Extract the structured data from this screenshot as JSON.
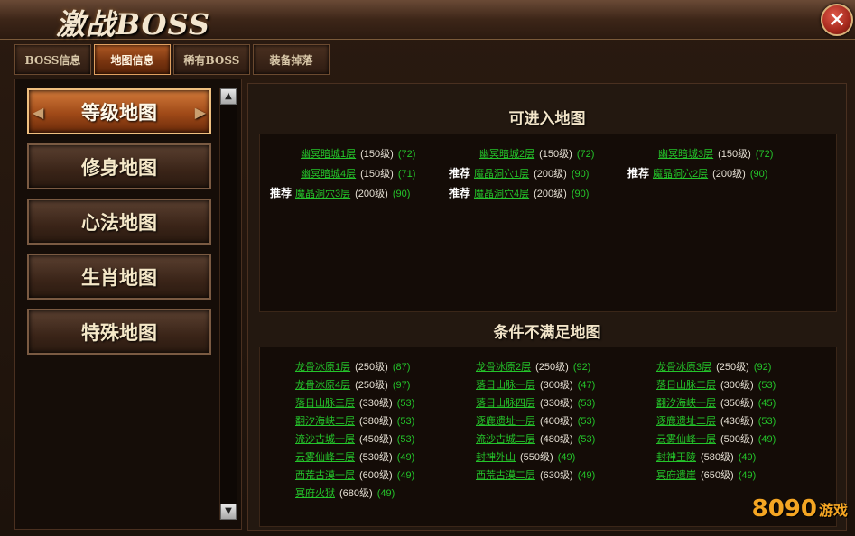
{
  "window": {
    "title": "激战BOSS",
    "close_label": "✕"
  },
  "tabs": [
    {
      "label": "BOSS信息",
      "active": false
    },
    {
      "label": "地图信息",
      "active": true
    },
    {
      "label": "稀有BOSS",
      "active": false
    },
    {
      "label": "装备掉落",
      "active": false
    }
  ],
  "map_categories": [
    {
      "label": "等级地图",
      "active": true
    },
    {
      "label": "修身地图",
      "active": false
    },
    {
      "label": "心法地图",
      "active": false
    },
    {
      "label": "生肖地图",
      "active": false
    },
    {
      "label": "特殊地图",
      "active": false
    }
  ],
  "scroll": {
    "up": "▲",
    "down": "▼"
  },
  "accessible": {
    "title": "可进入地图",
    "rec_label": "推荐",
    "entries": [
      {
        "rec": "",
        "name": "幽冥暗城1层",
        "level": "(150级)",
        "count": "(72)"
      },
      {
        "rec": "",
        "name": "幽冥暗城2层",
        "level": "(150级)",
        "count": "(72)"
      },
      {
        "rec": "",
        "name": "幽冥暗城3层",
        "level": "(150级)",
        "count": "(72)"
      },
      {
        "rec": "",
        "name": "幽冥暗城4层",
        "level": "(150级)",
        "count": "(71)"
      },
      {
        "rec": "推荐",
        "name": "魔晶洞穴1层",
        "level": "(200级)",
        "count": "(90)"
      },
      {
        "rec": "推荐",
        "name": "魔晶洞穴2层",
        "level": "(200级)",
        "count": "(90)"
      },
      {
        "rec": "推荐",
        "name": "魔晶洞穴3层",
        "level": "(200级)",
        "count": "(90)"
      },
      {
        "rec": "推荐",
        "name": "魔晶洞穴4层",
        "level": "(200级)",
        "count": "(90)"
      }
    ]
  },
  "unmet": {
    "title": "条件不满足地图",
    "entries": [
      {
        "name": "龙骨冰原1层",
        "level": "(250级)",
        "count": "(87)"
      },
      {
        "name": "龙骨冰原2层",
        "level": "(250级)",
        "count": "(92)"
      },
      {
        "name": "龙骨冰原3层",
        "level": "(250级)",
        "count": "(92)"
      },
      {
        "name": "龙骨冰原4层",
        "level": "(250级)",
        "count": "(97)"
      },
      {
        "name": "落日山脉一层",
        "level": "(300级)",
        "count": "(47)"
      },
      {
        "name": "落日山脉二层",
        "level": "(300级)",
        "count": "(53)"
      },
      {
        "name": "落日山脉三层",
        "level": "(330级)",
        "count": "(53)"
      },
      {
        "name": "落日山脉四层",
        "level": "(330级)",
        "count": "(53)"
      },
      {
        "name": "翻汐海峡一层",
        "level": "(350级)",
        "count": "(45)"
      },
      {
        "name": "翻汐海峡二层",
        "level": "(380级)",
        "count": "(53)"
      },
      {
        "name": "逐鹿遗址一层",
        "level": "(400级)",
        "count": "(53)"
      },
      {
        "name": "逐鹿遗址二层",
        "level": "(430级)",
        "count": "(53)"
      },
      {
        "name": "流沙古城一层",
        "level": "(450级)",
        "count": "(53)"
      },
      {
        "name": "流沙古城二层",
        "level": "(480级)",
        "count": "(53)"
      },
      {
        "name": "云雾仙峰一层",
        "level": "(500级)",
        "count": "(49)"
      },
      {
        "name": "云雾仙峰二层",
        "level": "(530级)",
        "count": "(49)"
      },
      {
        "name": "封神外山",
        "level": "(550级)",
        "count": "(49)"
      },
      {
        "name": "封神王陵",
        "level": "(580级)",
        "count": "(49)"
      },
      {
        "name": "西荒古漠一层",
        "level": "(600级)",
        "count": "(49)"
      },
      {
        "name": "西荒古漠二层",
        "level": "(630级)",
        "count": "(49)"
      },
      {
        "name": "冥府遗崖",
        "level": "(650级)",
        "count": "(49)"
      },
      {
        "name": "冥府火狱",
        "level": "(680级)",
        "count": "(49)"
      }
    ]
  },
  "watermark": {
    "number": "8090",
    "text": "游戏"
  }
}
